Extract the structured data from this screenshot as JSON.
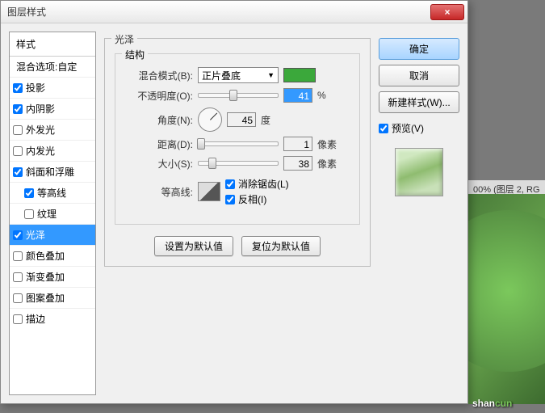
{
  "bg": {
    "tab_text": "00% (图层 2, RG"
  },
  "watermark": {
    "text_pre": "shan",
    "text_post": "cun"
  },
  "dialog": {
    "title": "图层样式",
    "close_label": "×",
    "left": {
      "header": "样式",
      "blend_options": "混合选项:自定",
      "drop_shadow": "投影",
      "inner_shadow": "内阴影",
      "outer_glow": "外发光",
      "inner_glow": "内发光",
      "bevel": "斜面和浮雕",
      "contour": "等高线",
      "texture": "纹理",
      "satin": "光泽",
      "color_overlay": "颜色叠加",
      "grad_overlay": "渐变叠加",
      "pattern_overlay": "图案叠加",
      "stroke": "描边"
    },
    "center": {
      "title": "光泽",
      "structure": "结构",
      "blend_mode_label": "混合模式(B):",
      "blend_mode_value": "正片叠底",
      "opacity_label": "不透明度(O):",
      "opacity_value": "41",
      "percent": "%",
      "angle_label": "角度(N):",
      "angle_value": "45",
      "angle_unit": "度",
      "distance_label": "距离(D):",
      "distance_value": "1",
      "px": "像素",
      "size_label": "大小(S):",
      "size_value": "38",
      "contour_label": "等高线:",
      "antialias": "消除锯齿(L)",
      "invert": "反相(I)",
      "make_default": "设置为默认值",
      "reset_default": "复位为默认值"
    },
    "right": {
      "ok": "确定",
      "cancel": "取消",
      "new_style": "新建样式(W)...",
      "preview": "预览(V)"
    }
  }
}
